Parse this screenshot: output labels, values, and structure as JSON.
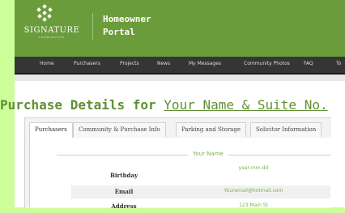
{
  "brand": {
    "logo_name": "SIGNATURE",
    "logo_sub": "COMMUNITIES",
    "portal_line1": "Homeowner",
    "portal_line2": "Portal",
    "header_color": "#6b9c3c",
    "accent_green": "#7fb14a",
    "side_background": "#ccff99"
  },
  "nav": {
    "items": [
      "Home",
      "Purchasers",
      "Projects",
      "News",
      "My Messages",
      "Community Photos",
      "FAQ",
      "To"
    ]
  },
  "page": {
    "title_prefix": "Purchase Details for ",
    "title_link": "Your Name & Suite No."
  },
  "tabs": [
    "Purchasers",
    "Community & Purchase Info",
    "Parking and Storage",
    "Solicitor Information"
  ],
  "purchaser": {
    "legend": "Your Name",
    "fields": [
      {
        "label": "Birthday",
        "value": "year-mm-dd"
      },
      {
        "label": "Email",
        "value": "Youremail@hotmail.com"
      },
      {
        "label": "Address",
        "value": "123 Main St"
      }
    ]
  }
}
